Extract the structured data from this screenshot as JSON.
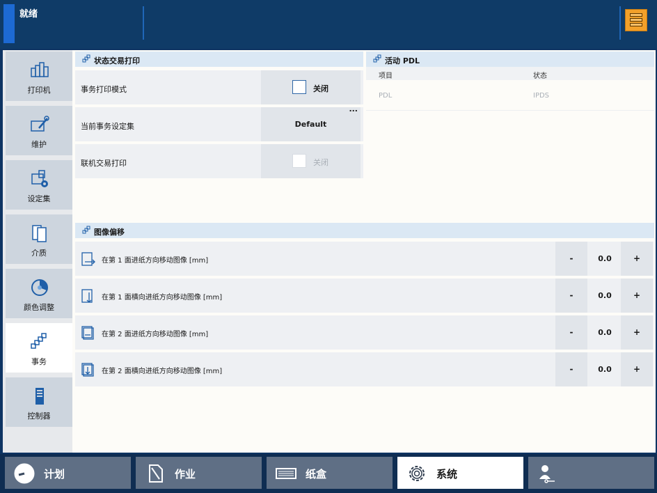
{
  "header": {
    "status": "就绪"
  },
  "sidebar": {
    "items": [
      {
        "label": "打印机",
        "icon": "printer-icon"
      },
      {
        "label": "维护",
        "icon": "maintenance-icon"
      },
      {
        "label": "设定集",
        "icon": "presets-icon"
      },
      {
        "label": "介质",
        "icon": "media-icon"
      },
      {
        "label": "颜色调整",
        "icon": "color-adjust-icon"
      },
      {
        "label": "事务",
        "icon": "transaction-icon",
        "active": true
      },
      {
        "label": "控制器",
        "icon": "controller-icon"
      }
    ]
  },
  "transaction_print": {
    "title": "状态交易打印",
    "rows": [
      {
        "label": "事务打印模式",
        "value": "关闭"
      },
      {
        "label": "当前事务设定集",
        "value": "Default",
        "more": "..."
      },
      {
        "label": "联机交易打印",
        "value": "关闭"
      }
    ]
  },
  "active_pdl": {
    "title": "活动 PDL",
    "columns": [
      "项目",
      "状态"
    ],
    "rows": [
      {
        "item": "PDL",
        "status": "IPDS"
      }
    ]
  },
  "image_shift": {
    "title": "图像偏移",
    "rows": [
      {
        "label": "在第 1 面进纸方向移动图像 [mm]",
        "value": "0.0"
      },
      {
        "label": "在第 1 面横向进纸方向移动图像 [mm]",
        "value": "0.0"
      },
      {
        "label": "在第 2 面进纸方向移动图像 [mm]",
        "value": "0.0"
      },
      {
        "label": "在第 2 面横向进纸方向移动图像 [mm]",
        "value": "0.0"
      }
    ],
    "minus": "-",
    "plus": "+"
  },
  "tabs": [
    {
      "label": "计划",
      "icon": "clock-icon"
    },
    {
      "label": "作业",
      "icon": "document-icon"
    },
    {
      "label": "纸盒",
      "icon": "paper-tray-icon"
    },
    {
      "label": "系统",
      "icon": "gear-icon",
      "active": true
    },
    {
      "label": "",
      "icon": "user-key-icon"
    }
  ],
  "colors": {
    "header": "#0f3b67",
    "accent": "#1d6ad3",
    "menu": "#f2a02a",
    "section": "#dbe8f4",
    "tab": "#5f6f85"
  }
}
